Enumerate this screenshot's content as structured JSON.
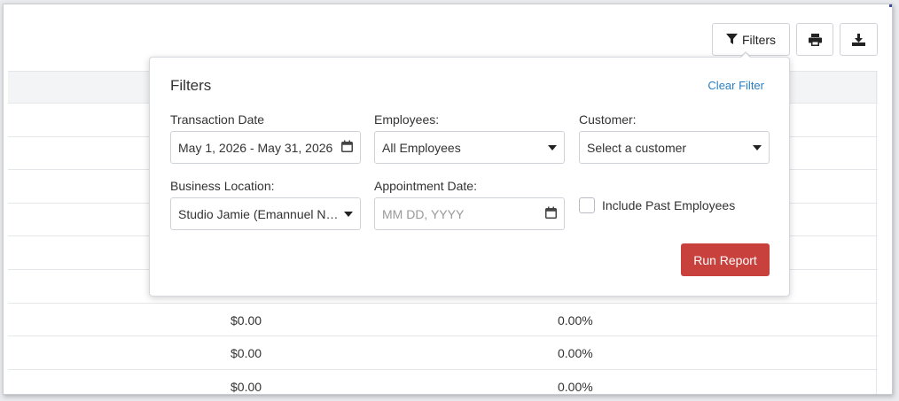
{
  "toolbar": {
    "filters_label": "Filters",
    "filter_icon": "filter-icon",
    "print_icon": "print-icon",
    "download_icon": "download-icon"
  },
  "filters_panel": {
    "title": "Filters",
    "clear_label": "Clear Filter",
    "transaction_date": {
      "label": "Transaction Date",
      "value": "May 1, 2026 - May 31, 2026"
    },
    "employees": {
      "label": "Employees:",
      "value": "All Employees"
    },
    "customer": {
      "label": "Customer:",
      "placeholder": "Select a customer"
    },
    "business_location": {
      "label": "Business Location:",
      "value": "Studio Jamie (Emannuel Nev..."
    },
    "appointment_date": {
      "label": "Appointment Date:",
      "placeholder": "MM DD, YYYY"
    },
    "include_past_employees": {
      "label": "Include Past Employees",
      "checked": false
    },
    "run_label": "Run Report"
  },
  "table": {
    "rows": [
      {
        "amount": "$0.00",
        "percent": "0.00%"
      },
      {
        "amount": "$0.00",
        "percent": "0.00%"
      },
      {
        "amount": "$0.00",
        "percent": "0.00%"
      }
    ]
  },
  "colors": {
    "accent": "#2a7fc4",
    "run_button": "#c9413d"
  }
}
